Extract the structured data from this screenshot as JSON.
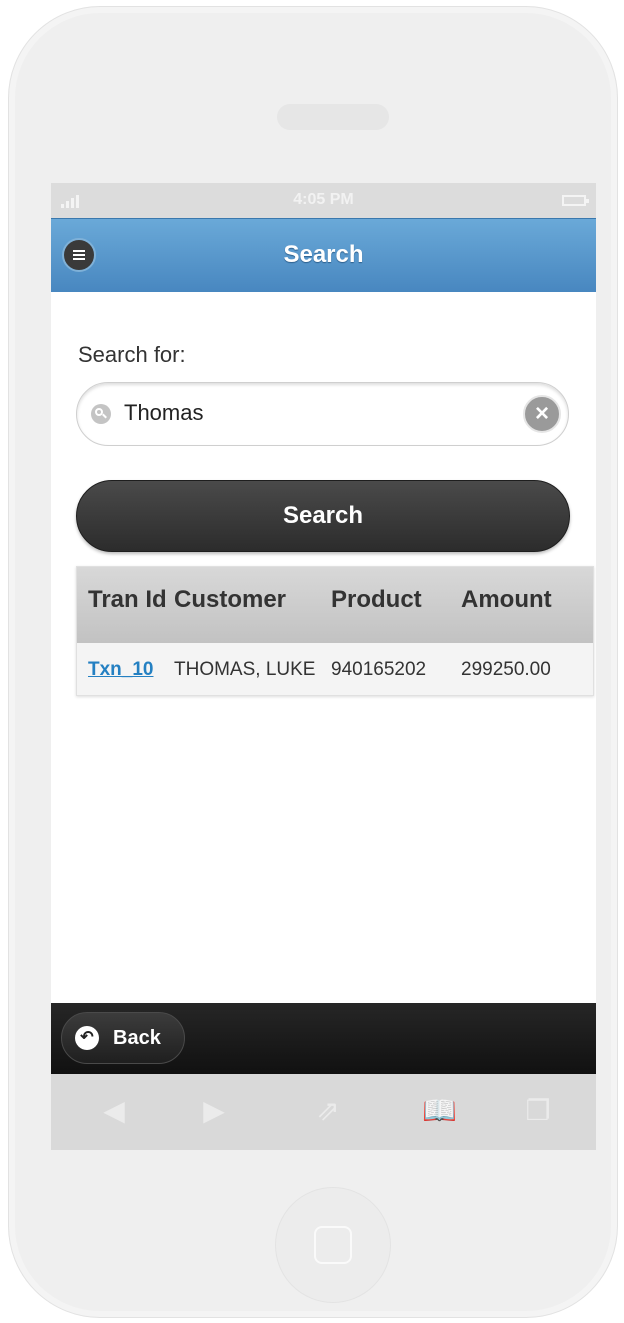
{
  "status_bar": {
    "time": "4:05 PM"
  },
  "header": {
    "title": "Search"
  },
  "search": {
    "label": "Search for:",
    "value": "Thomas",
    "button_label": "Search"
  },
  "table": {
    "headers": [
      "Tran Id",
      "Customer",
      "Product",
      "Amount"
    ],
    "rows": [
      {
        "tran_id": "Txn_10",
        "customer": "THOMAS, LUKE",
        "product": "940165202",
        "amount": "299250.00"
      }
    ]
  },
  "footer": {
    "back_label": "Back"
  },
  "icons": {
    "menu": "menu-icon",
    "search": "search-icon",
    "clear": "clear-icon",
    "back": "back-arrow-icon",
    "browser": [
      "back-arrow-icon",
      "forward-arrow-icon",
      "share-icon",
      "bookmarks-icon",
      "tabs-icon"
    ]
  },
  "colors": {
    "header_blue": "#5a9bd0",
    "link_blue": "#2480c2",
    "button_dark": "#2c2c2c"
  }
}
